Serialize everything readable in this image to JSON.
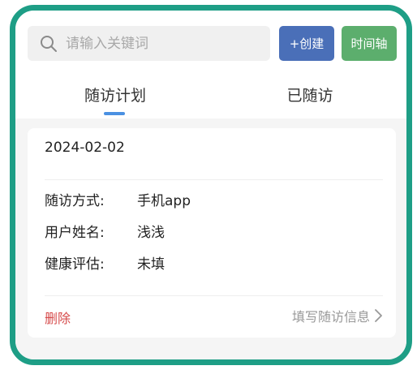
{
  "search": {
    "placeholder": "请输入关键词",
    "value": ""
  },
  "toolbar": {
    "create_label": "+创建",
    "timeline_label": "时间轴"
  },
  "tabs": [
    {
      "label": "随访计划",
      "active": true
    },
    {
      "label": "已随访",
      "active": false
    }
  ],
  "card": {
    "date": "2024-02-02",
    "fields": [
      {
        "label": "随访方式:",
        "value": "手机app"
      },
      {
        "label": "用户姓名:",
        "value": "浅浅"
      },
      {
        "label": "健康评估:",
        "value": "未填"
      }
    ],
    "delete_label": "删除",
    "fill_label": "填写随访信息"
  },
  "colors": {
    "frame": "#1e9e86",
    "create_button": "#4a6fb8",
    "timeline_button": "#5cae6d",
    "tab_indicator": "#4a90e2",
    "delete_text": "#d64b4b"
  },
  "icons": {
    "search": "search-icon",
    "chevron": "chevron-right-icon"
  }
}
